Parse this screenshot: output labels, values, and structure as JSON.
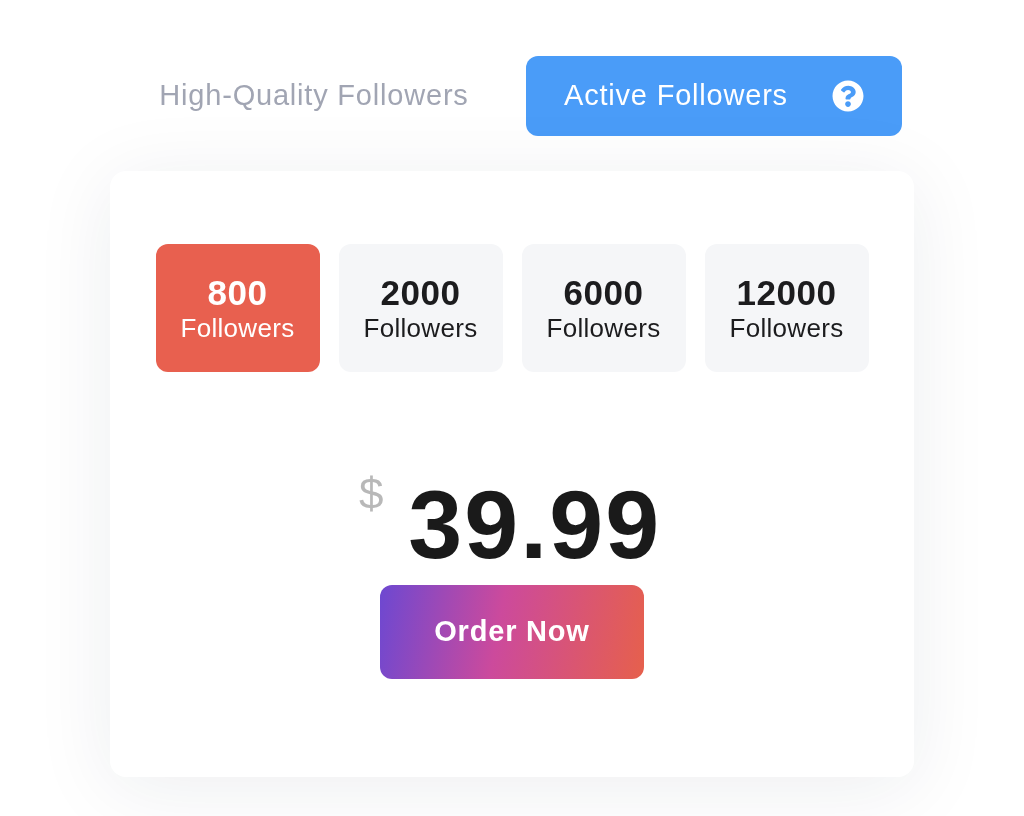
{
  "tabs": [
    {
      "label": "High-Quality Followers",
      "selected": false
    },
    {
      "label": "Active Followers",
      "selected": true,
      "help_icon": true
    }
  ],
  "packages": [
    {
      "count": "800",
      "unit": "Followers",
      "selected": true
    },
    {
      "count": "2000",
      "unit": "Followers",
      "selected": false
    },
    {
      "count": "6000",
      "unit": "Followers",
      "selected": false
    },
    {
      "count": "12000",
      "unit": "Followers",
      "selected": false
    }
  ],
  "price": {
    "currency": "$",
    "amount": "39.99"
  },
  "order_button": {
    "label": "Order Now"
  }
}
